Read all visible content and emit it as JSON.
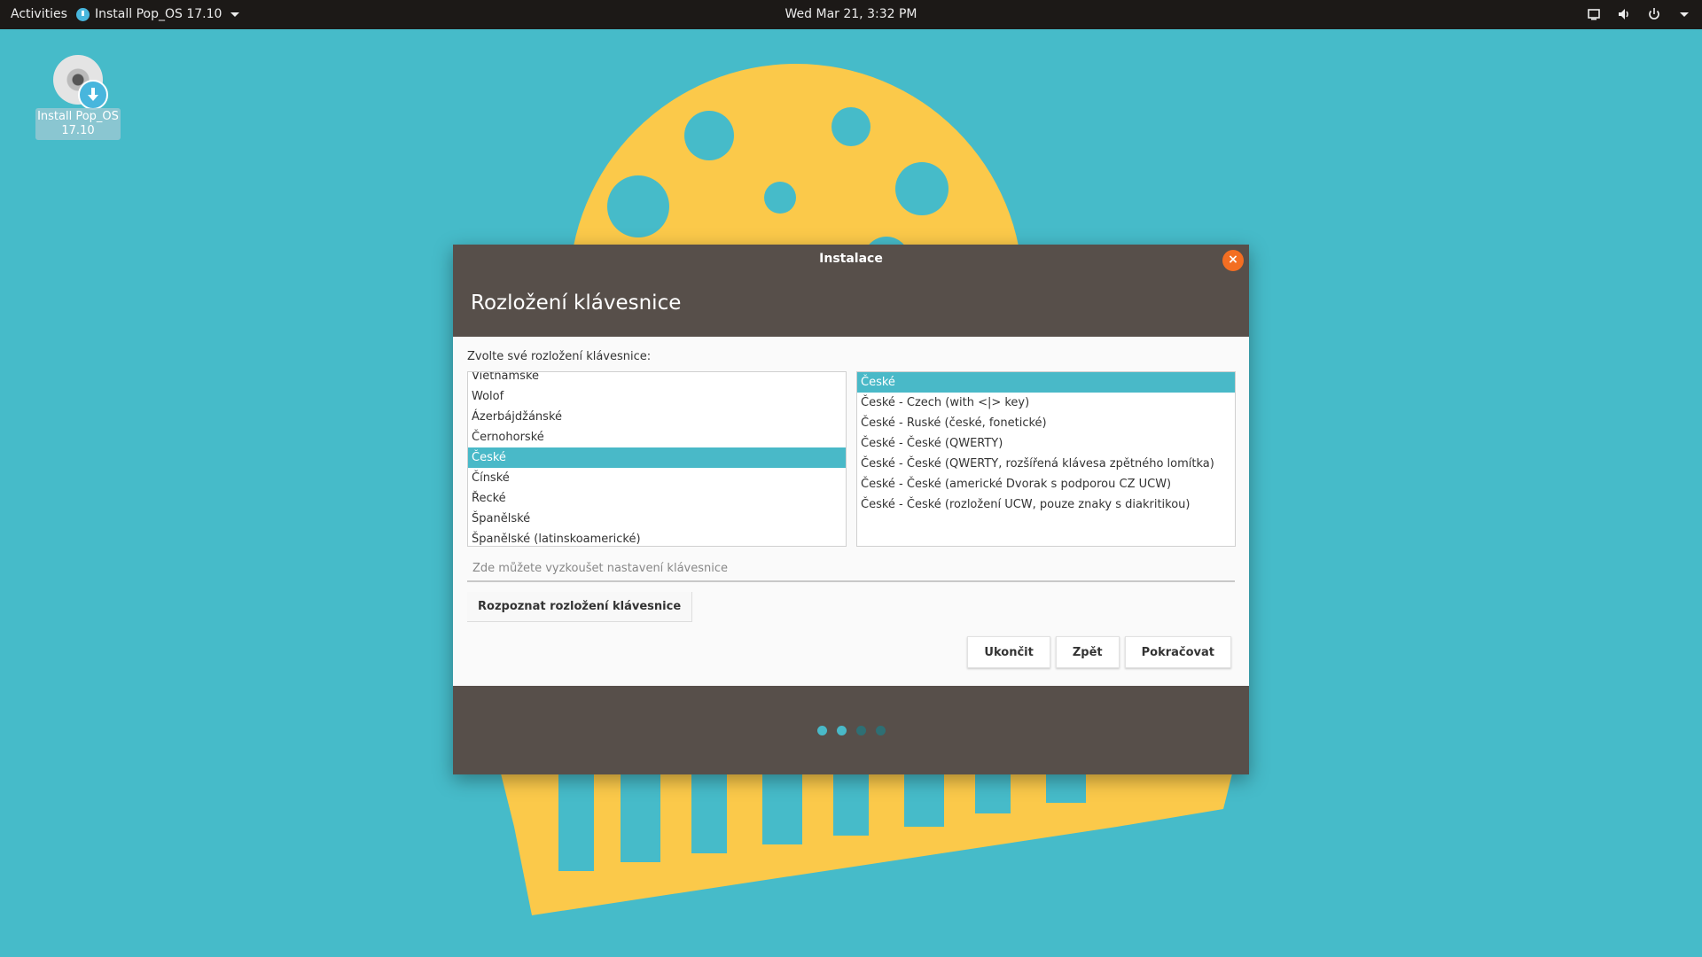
{
  "topbar": {
    "activities": "Activities",
    "app_menu": "Install Pop_OS 17.10",
    "clock": "Wed Mar 21,  3:32 PM"
  },
  "desktop": {
    "icon_label": "Install Pop_OS 17.10"
  },
  "dialog": {
    "window_title": "Instalace",
    "close_glyph": "×",
    "page_title": "Rozložení klávesnice",
    "prompt": "Zvolte své rozložení klávesnice:",
    "layouts": [
      "Vietnamské",
      "Wolof",
      "Ázerbájdžánské",
      "Černohorské",
      "České",
      "Čínské",
      "Řecké",
      "Španělské",
      "Španělské (latinskoamerické)"
    ],
    "layouts_selected_index": 4,
    "variants": [
      "České",
      "České - Czech (with <|> key)",
      "České - Ruské (české, fonetické)",
      "České - České (QWERTY)",
      "České - České (QWERTY, rozšířená klávesa zpětného lomítka)",
      "České - České (americké Dvorak s podporou CZ UCW)",
      "České - České (rozložení UCW, pouze znaky s diakritikou)"
    ],
    "variants_selected_index": 0,
    "test_placeholder": "Zde můžete vyzkoušet nastavení klávesnice",
    "detect_button": "Rozpoznat rozložení klávesnice",
    "quit_button": "Ukončit",
    "back_button": "Zpět",
    "continue_button": "Pokračovat",
    "progress": {
      "total_steps": 4,
      "active_steps": 2
    }
  },
  "colors": {
    "desktop_bg": "#46bbc9",
    "wallpaper_yellow": "#fbc94a",
    "topbar_bg": "#1c1917",
    "dialog_header": "#574f4a",
    "selection": "#49b9c8",
    "close_button": "#f36e22"
  }
}
